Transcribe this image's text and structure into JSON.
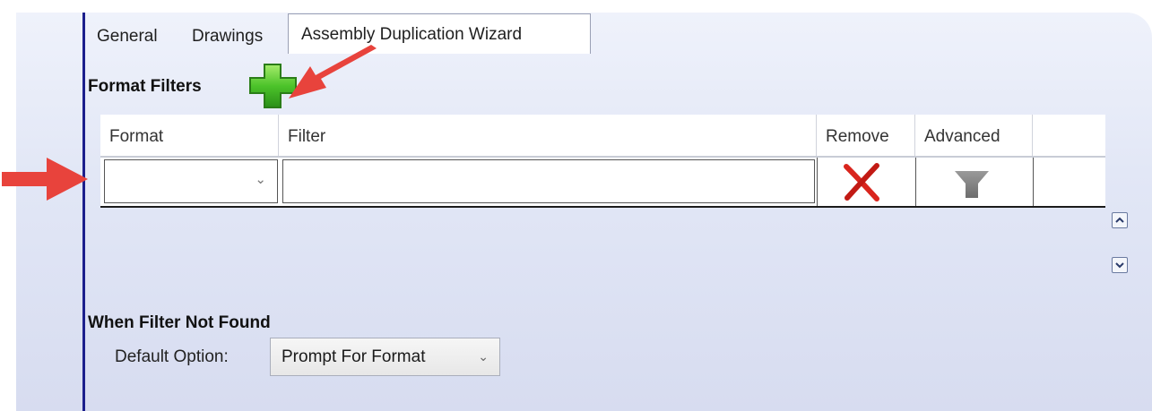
{
  "tabs": [
    {
      "label": "General",
      "active": false
    },
    {
      "label": "Drawings",
      "active": false
    },
    {
      "label": "Assembly Duplication Wizard",
      "active": true
    }
  ],
  "format_filters": {
    "title": "Format Filters",
    "add_icon": "green-plus-icon",
    "columns": [
      "Format",
      "Filter",
      "Remove",
      "Advanced"
    ],
    "rows": [
      {
        "format": "",
        "filter": "",
        "remove_icon": "red-x-icon",
        "advanced_icon": "funnel-icon"
      }
    ],
    "scroll_up_icon": "chevron-up-icon",
    "scroll_down_icon": "chevron-down-icon"
  },
  "not_found": {
    "title": "When Filter Not Found",
    "default_option_label": "Default Option:",
    "default_option_value": "Prompt For Format"
  },
  "colors": {
    "accent_line": "#1c1f8c",
    "annotation_arrow": "#e8433c",
    "add_green": "#4cc32a",
    "remove_red": "#d9251d"
  }
}
